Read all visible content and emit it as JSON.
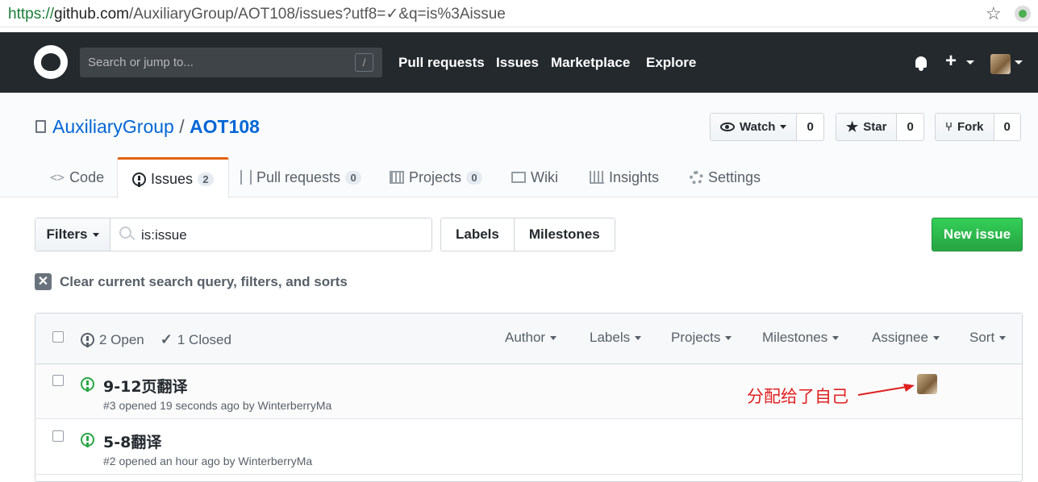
{
  "browser": {
    "url_scheme": "https://",
    "url_host": "github.com",
    "url_path": "/AuxiliaryGroup/AOT108/issues?utf8=✓&q=is%3Aissue",
    "bookmark_icon": "star-outline-icon"
  },
  "header": {
    "logo": "github-logo-icon",
    "search_placeholder": "Search or jump to...",
    "search_shortcut": "/",
    "nav": [
      "Pull requests",
      "Issues",
      "Marketplace",
      "Explore"
    ],
    "bg_color": "#24292e"
  },
  "repo": {
    "owner": "AuxiliaryGroup",
    "separator": "/",
    "name": "AOT108",
    "watch_label": "Watch",
    "watch_count": "0",
    "star_label": "Star",
    "star_count": "0",
    "fork_label": "Fork",
    "fork_count": "0"
  },
  "tabs": {
    "code": "Code",
    "issues": "Issues",
    "issues_count": "2",
    "pull_requests": "Pull requests",
    "pull_requests_count": "0",
    "projects": "Projects",
    "projects_count": "0",
    "wiki": "Wiki",
    "insights": "Insights",
    "settings": "Settings",
    "selected_accent": "#e36209"
  },
  "toolbar": {
    "filters_label": "Filters",
    "query": "is:issue",
    "labels_label": "Labels",
    "milestones_label": "Milestones",
    "new_issue_label": "New issue",
    "new_issue_color": "#28a745"
  },
  "clear": {
    "text": "Clear current search query, filters, and sorts"
  },
  "list_header": {
    "open_label": "2 Open",
    "closed_label": "1 Closed",
    "menus": [
      "Author",
      "Labels",
      "Projects",
      "Milestones",
      "Assignee",
      "Sort"
    ]
  },
  "issues": [
    {
      "title": "9-12页翻译",
      "meta": "#3 opened 19 seconds ago by WinterberryMa",
      "has_assignee": true
    },
    {
      "title": "5-8翻译",
      "meta": "#2 opened an hour ago by WinterberryMa",
      "has_assignee": false
    }
  ],
  "annotation": {
    "text": "分配给了自己",
    "color": "#e02020"
  }
}
